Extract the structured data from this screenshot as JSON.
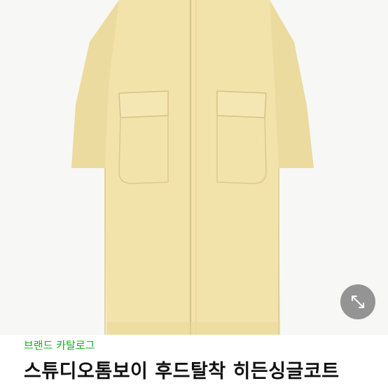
{
  "product": {
    "image_alt": "coat photo",
    "brand_link": "브랜드 카탈로그",
    "title": "스튜디오톰보이 후드탈착 히든싱글코트"
  },
  "icons": {
    "expand": "expand-arrows-icon"
  },
  "colors": {
    "brand_green": "#0fb21a",
    "coat": "#f0e1a8",
    "overlay_button": "#787878"
  }
}
